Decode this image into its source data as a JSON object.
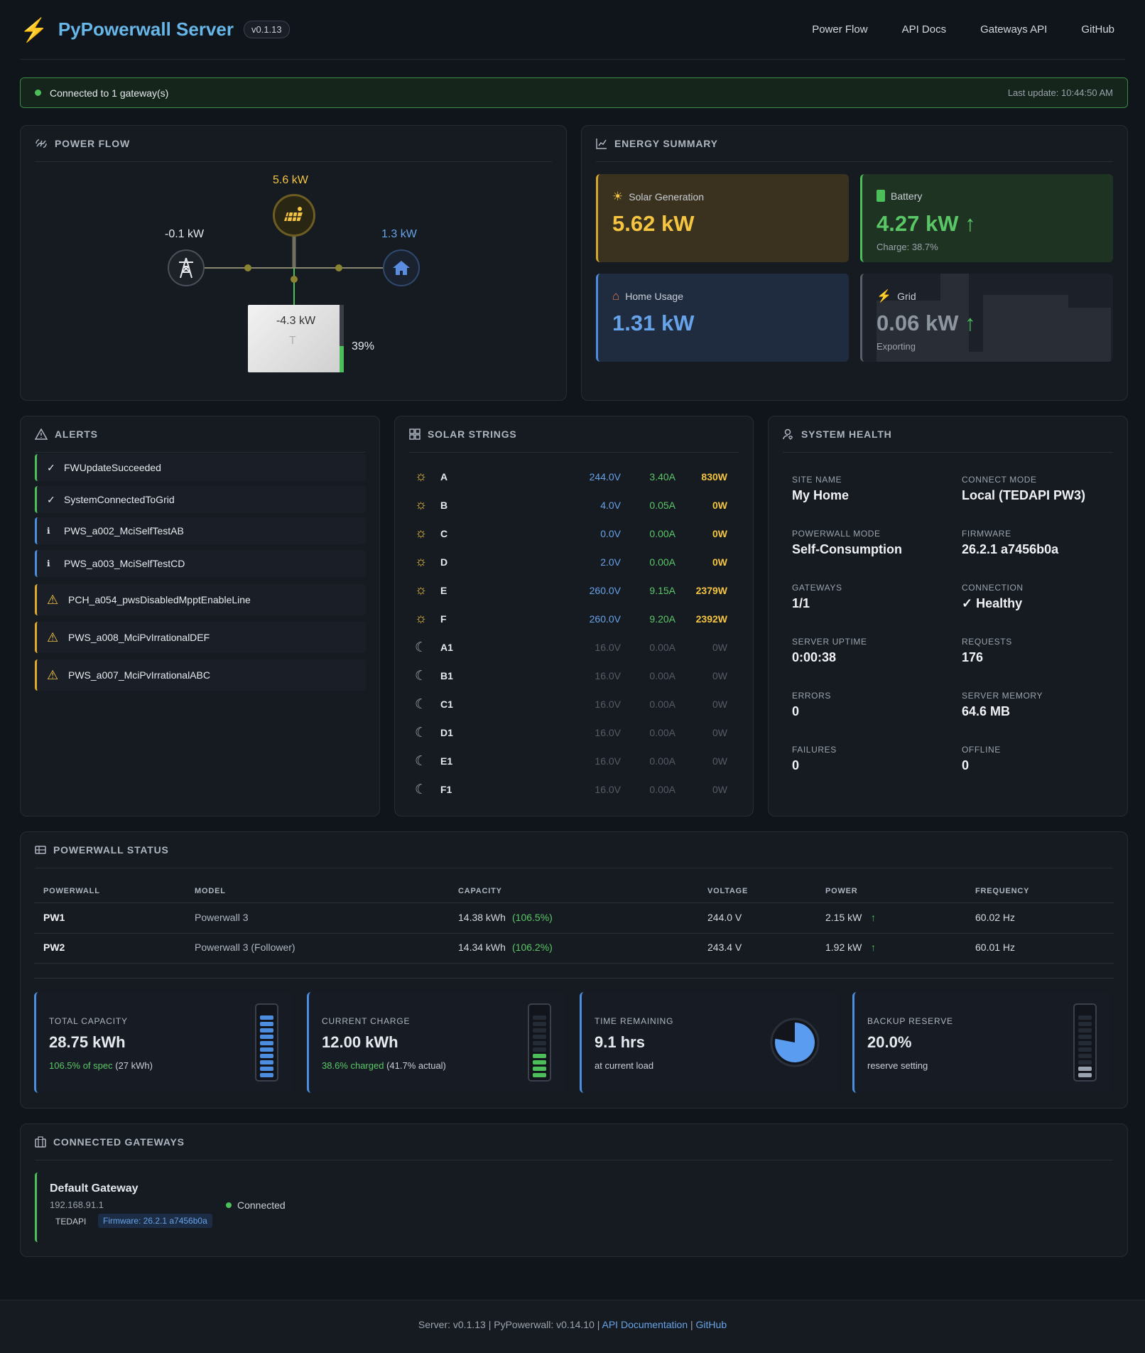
{
  "header": {
    "title": "PyPowerwall Server",
    "version": "v0.1.13",
    "nav": [
      "Power Flow",
      "API Docs",
      "Gateways API",
      "GitHub"
    ]
  },
  "connection": {
    "status": "Connected to 1 gateway(s)",
    "last_update": "Last update: 10:44:50 AM"
  },
  "power_flow": {
    "title": "POWER FLOW",
    "solar": "5.6 kW",
    "grid": "-0.1 kW",
    "home": "1.3 kW",
    "battery": "-4.3 kW",
    "battery_pct": "39%",
    "battery_level": 0.39
  },
  "energy_summary": {
    "title": "ENERGY SUMMARY",
    "solar": {
      "label": "Solar Generation",
      "value": "5.62 kW"
    },
    "battery": {
      "label": "Battery",
      "value": "4.27 kW",
      "sub": "Charge: 38.7%"
    },
    "home": {
      "label": "Home Usage",
      "value": "1.31 kW"
    },
    "grid": {
      "label": "Grid",
      "value": "0.06 kW",
      "sub": "Exporting"
    }
  },
  "alerts": {
    "title": "ALERTS",
    "items": [
      {
        "text": "FWUpdateSucceeded",
        "level": "success",
        "icon": "check-icon"
      },
      {
        "text": "SystemConnectedToGrid",
        "level": "success",
        "icon": "check-icon"
      },
      {
        "text": "PWS_a002_MciSelfTestAB",
        "level": "info",
        "icon": "info-icon"
      },
      {
        "text": "PWS_a003_MciSelfTestCD",
        "level": "info",
        "icon": "info-icon"
      },
      {
        "text": "PCH_a054_pwsDisabledMpptEnableLine",
        "level": "warning",
        "icon": "warning-icon"
      },
      {
        "text": "PWS_a008_MciPvIrrationalDEF",
        "level": "warning",
        "icon": "warning-icon"
      },
      {
        "text": "PWS_a007_MciPvIrrationalABC",
        "level": "warning",
        "icon": "warning-icon"
      }
    ]
  },
  "solar_strings": {
    "title": "SOLAR STRINGS",
    "rows": [
      {
        "name": "A",
        "voltage": "244.0V",
        "current": "3.40A",
        "power": "830W",
        "active": true
      },
      {
        "name": "B",
        "voltage": "4.0V",
        "current": "0.05A",
        "power": "0W",
        "active": true
      },
      {
        "name": "C",
        "voltage": "0.0V",
        "current": "0.00A",
        "power": "0W",
        "active": true
      },
      {
        "name": "D",
        "voltage": "2.0V",
        "current": "0.00A",
        "power": "0W",
        "active": true
      },
      {
        "name": "E",
        "voltage": "260.0V",
        "current": "9.15A",
        "power": "2379W",
        "active": true
      },
      {
        "name": "F",
        "voltage": "260.0V",
        "current": "9.20A",
        "power": "2392W",
        "active": true
      },
      {
        "name": "A1",
        "voltage": "16.0V",
        "current": "0.00A",
        "power": "0W",
        "active": false
      },
      {
        "name": "B1",
        "voltage": "16.0V",
        "current": "0.00A",
        "power": "0W",
        "active": false
      },
      {
        "name": "C1",
        "voltage": "16.0V",
        "current": "0.00A",
        "power": "0W",
        "active": false
      },
      {
        "name": "D1",
        "voltage": "16.0V",
        "current": "0.00A",
        "power": "0W",
        "active": false
      },
      {
        "name": "E1",
        "voltage": "16.0V",
        "current": "0.00A",
        "power": "0W",
        "active": false
      },
      {
        "name": "F1",
        "voltage": "16.0V",
        "current": "0.00A",
        "power": "0W",
        "active": false
      }
    ]
  },
  "system_health": {
    "title": "SYSTEM HEALTH",
    "items": [
      {
        "label": "SITE NAME",
        "value": "My Home"
      },
      {
        "label": "CONNECT MODE",
        "value": "Local (TEDAPI PW3)"
      },
      {
        "label": "POWERWALL MODE",
        "value": "Self-Consumption"
      },
      {
        "label": "FIRMWARE",
        "value": "26.2.1 a7456b0a"
      },
      {
        "label": "GATEWAYS",
        "value": "1/1"
      },
      {
        "label": "CONNECTION",
        "value": "✓ Healthy"
      },
      {
        "label": "SERVER UPTIME",
        "value": "0:00:38"
      },
      {
        "label": "REQUESTS",
        "value": "176"
      },
      {
        "label": "ERRORS",
        "value": "0"
      },
      {
        "label": "SERVER MEMORY",
        "value": "64.6 MB"
      },
      {
        "label": "FAILURES",
        "value": "0"
      },
      {
        "label": "OFFLINE",
        "value": "0"
      }
    ]
  },
  "powerwall_status": {
    "title": "POWERWALL STATUS",
    "columns": [
      "POWERWALL",
      "MODEL",
      "CAPACITY",
      "VOLTAGE",
      "POWER",
      "FREQUENCY"
    ],
    "rows": [
      {
        "name": "PW1",
        "model": "Powerwall 3",
        "capacity": "14.38 kWh",
        "capacity_pct": "(106.5%)",
        "voltage": "244.0 V",
        "power": "2.15 kW",
        "frequency": "60.02 Hz"
      },
      {
        "name": "PW2",
        "model": "Powerwall 3 (Follower)",
        "capacity": "14.34 kWh",
        "capacity_pct": "(106.2%)",
        "voltage": "243.4 V",
        "power": "1.92 kW",
        "frequency": "60.01 Hz"
      }
    ],
    "stats": {
      "total_capacity": {
        "label": "TOTAL CAPACITY",
        "value": "28.75 kWh",
        "sub_green": "106.5% of spec",
        "sub": " (27 kWh)",
        "level": 1.0
      },
      "current_charge": {
        "label": "CURRENT CHARGE",
        "value": "12.00 kWh",
        "sub_green": "38.6% charged",
        "sub": " (41.7% actual)",
        "level": 0.417
      },
      "time_remaining": {
        "label": "TIME REMAINING",
        "value": "9.1 hrs",
        "sub": "at current load",
        "level": 0.78
      },
      "backup_reserve": {
        "label": "BACKUP RESERVE",
        "value": "20.0%",
        "sub": "reserve setting",
        "level": 0.2
      }
    }
  },
  "gateways": {
    "title": "CONNECTED GATEWAYS",
    "items": [
      {
        "name": "Default Gateway",
        "ip": "192.168.91.1",
        "type": "TEDAPI",
        "firmware": "Firmware: 26.2.1 a7456b0a",
        "status": "Connected"
      }
    ]
  },
  "footer": {
    "text": "Server: v0.1.13 | PyPowerwall: v0.14.10 | ",
    "api_link": "API Documentation",
    "sep": " | ",
    "github_link": "GitHub"
  },
  "colors": {
    "solar": "#f5c542",
    "battery": "#4cbf5a",
    "home": "#67a3e8",
    "grid": "#9aa3ad",
    "warning": "#e0a82e",
    "info": "#4c8de0"
  }
}
